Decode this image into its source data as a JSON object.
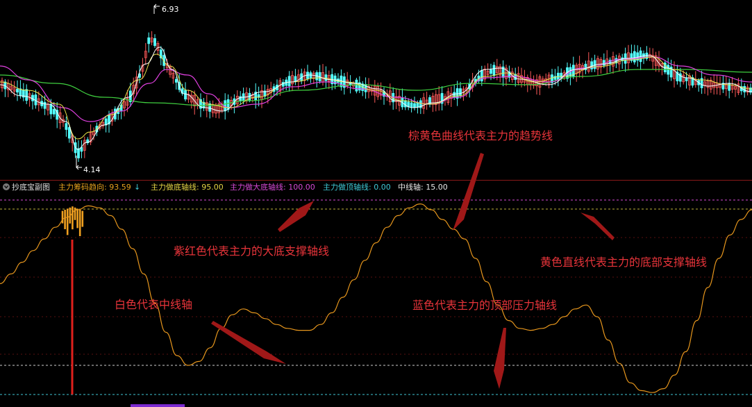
{
  "top_chart": {
    "price_high_label": "6.93",
    "price_low_label": "4.14"
  },
  "indicator_header": {
    "title": "抄底宝副图",
    "items": [
      {
        "label": "主力筹码趋向: 93.59",
        "arrow": "↓",
        "color": "#e6a21d"
      },
      {
        "label": "主力做底轴线: 95.00",
        "color": "#e3d445"
      },
      {
        "label": "主力做大底轴线: 100.00",
        "color": "#d64ad6"
      },
      {
        "label": "主力做顶轴线: 0.00",
        "color": "#3fc9d6"
      },
      {
        "label": "中线轴: 15.00",
        "color": "#e8e8e8"
      }
    ]
  },
  "annotations": [
    {
      "text": "棕黄色曲线代表主力的趋势线"
    },
    {
      "text": "紫红色代表主力的大底支撑轴线"
    },
    {
      "text": "黄色直线代表主力的底部支撑轴线"
    },
    {
      "text": "白色代表中线轴"
    },
    {
      "text": "蓝色代表主力的顶部压力轴线"
    }
  ],
  "colors": {
    "background": "#000000",
    "candle_up": "#ff5a5a",
    "candle_down": "#54ffff",
    "ma_white": "#ffffff",
    "ma_yellow": "#e8e24a",
    "ma_magenta": "#e040e0",
    "ma_green": "#3fcf3f",
    "trend_line": "#e6961d",
    "annotation": "#e8343a",
    "arrow": "#a01818",
    "separator": "#8a1a1a"
  },
  "chart_data": {
    "type": "line",
    "title": "抄底宝副图",
    "reference_lines": [
      {
        "name": "主力做大底轴线",
        "value": 100.0,
        "color": "#d64ad6"
      },
      {
        "name": "主力做底轴线",
        "value": 95.0,
        "color": "#e3d445"
      },
      {
        "name": "中线轴",
        "value": 15.0,
        "color": "#e8e8e8"
      },
      {
        "name": "主力做顶轴线",
        "value": 0.0,
        "color": "#3fc9d6"
      }
    ],
    "ylim": [
      0,
      100
    ],
    "series": [
      {
        "name": "主力筹码趋向",
        "last_value": 93.59,
        "values": [
          57,
          62,
          68,
          74,
          80,
          86,
          91,
          95,
          97,
          96,
          92,
          85,
          75,
          62,
          47,
          32,
          20,
          15,
          17,
          24,
          34,
          41,
          44,
          42,
          39,
          36,
          34,
          33,
          33,
          36,
          42,
          50,
          59,
          69,
          78,
          86,
          92,
          96,
          98,
          95,
          90,
          85,
          80,
          70,
          58,
          46,
          38,
          34,
          33,
          34,
          36,
          40,
          44,
          46,
          40,
          28,
          16,
          6,
          2,
          1,
          3,
          10,
          22,
          38,
          55,
          70,
          82,
          90,
          95
        ]
      }
    ]
  }
}
